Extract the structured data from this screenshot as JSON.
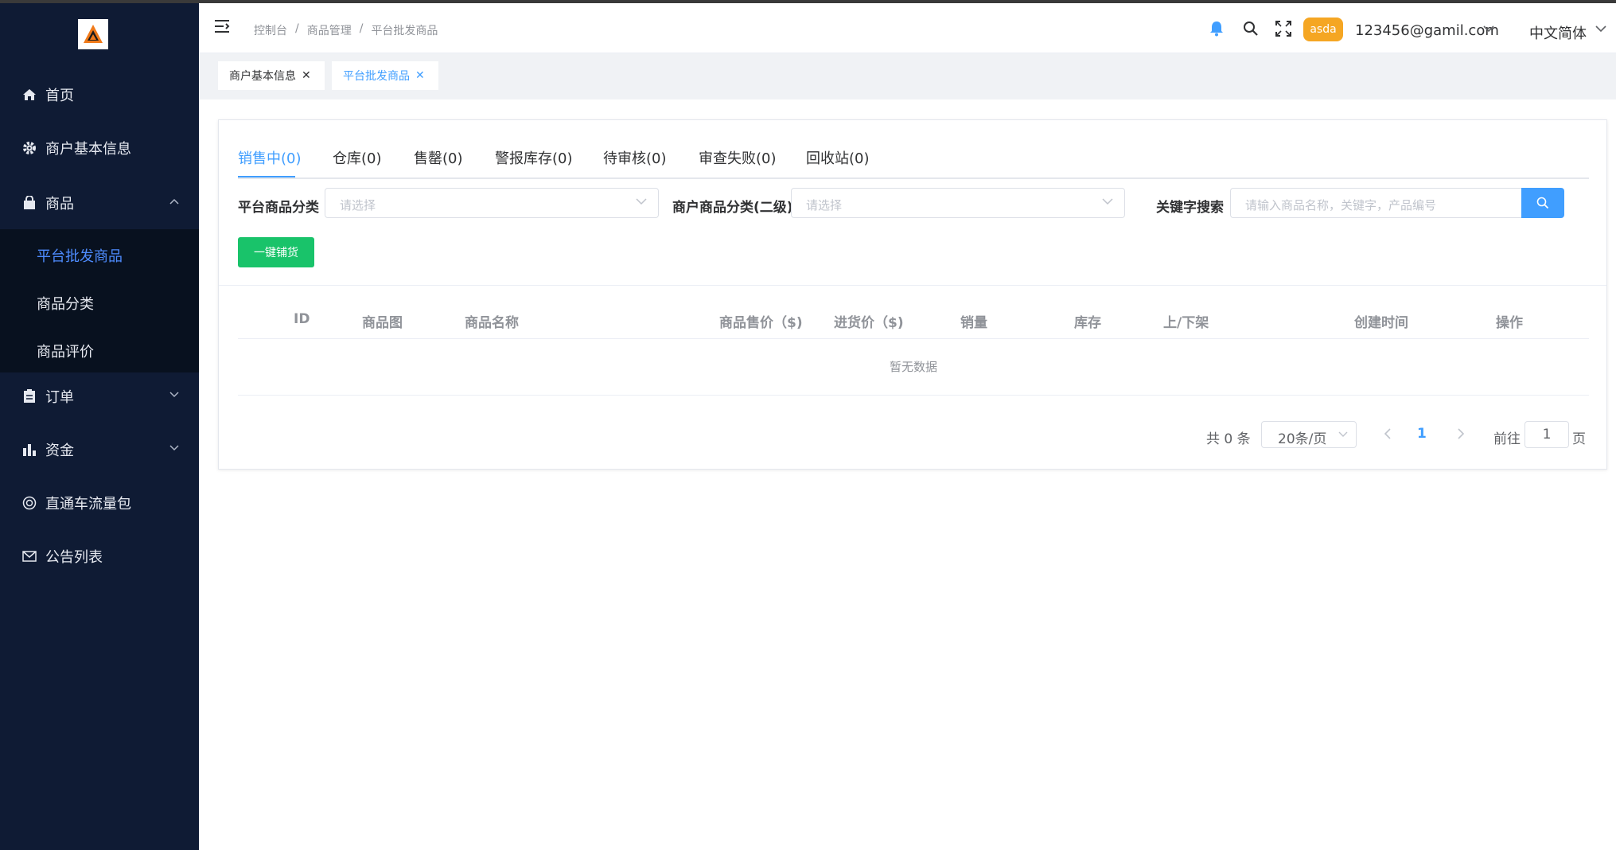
{
  "sidebar": {
    "logo_icon": "triangle-logo-icon",
    "items": [
      {
        "label": "首页",
        "icon": "home-icon"
      },
      {
        "label": "商户基本信息",
        "icon": "gear-icon"
      },
      {
        "label": "商品",
        "icon": "bag-icon"
      },
      {
        "label": "订单",
        "icon": "clipboard-icon"
      },
      {
        "label": "资金",
        "icon": "bar-chart-icon"
      },
      {
        "label": "直通车流量包",
        "icon": "lifebuoy-icon"
      },
      {
        "label": "公告列表",
        "icon": "mail-icon"
      }
    ],
    "submenu": [
      {
        "label": "平台批发商品",
        "active": true
      },
      {
        "label": "商品分类"
      },
      {
        "label": "商品评价"
      }
    ],
    "colors": {
      "bg": "#0f1b34",
      "submenu_bg": "#08111f",
      "active": "#4e8cff"
    }
  },
  "header": {
    "breadcrumb": [
      "控制台",
      "商品管理",
      "平台批发商品"
    ],
    "breadcrumb_sep": "/",
    "avatar_text": "asda",
    "user_email": "123456@gamil.com",
    "language": "中文简体",
    "icons": [
      "menu-fold-icon",
      "bell-icon",
      "search-icon",
      "fullscreen-icon"
    ]
  },
  "tags": [
    {
      "label": "商户基本信息",
      "active": false
    },
    {
      "label": "平台批发商品",
      "active": true
    }
  ],
  "tabs": [
    "销售中(0)",
    "仓库(0)",
    "售罄(0)",
    "警报库存(0)",
    "待审核(0)",
    "审查失败(0)",
    "回收站(0)"
  ],
  "filters": {
    "platform_category_label": "平台商品分类",
    "platform_category_placeholder": "请选择",
    "merchant_category_label": "商户商品分类(二级)",
    "merchant_category_placeholder": "请选择",
    "keyword_label": "关键字搜索",
    "keyword_placeholder": "请输入商品名称，关键字，产品编号"
  },
  "actions": {
    "one_click_stock": "一键铺货"
  },
  "table": {
    "columns": [
      "ID",
      "商品图",
      "商品名称",
      "商品售价（$)",
      "进货价（$)",
      "销量",
      "库存",
      "上/下架",
      "创建时间",
      "操作"
    ],
    "empty_text": "暂无数据"
  },
  "pagination": {
    "total_text": "共 0 条",
    "page_size": "20条/页",
    "current_page": "1",
    "goto_label": "前往",
    "goto_value": "1",
    "goto_suffix": "页"
  },
  "colors": {
    "primary": "#409eff",
    "success": "#19c36a",
    "avatar": "#f5a623"
  }
}
